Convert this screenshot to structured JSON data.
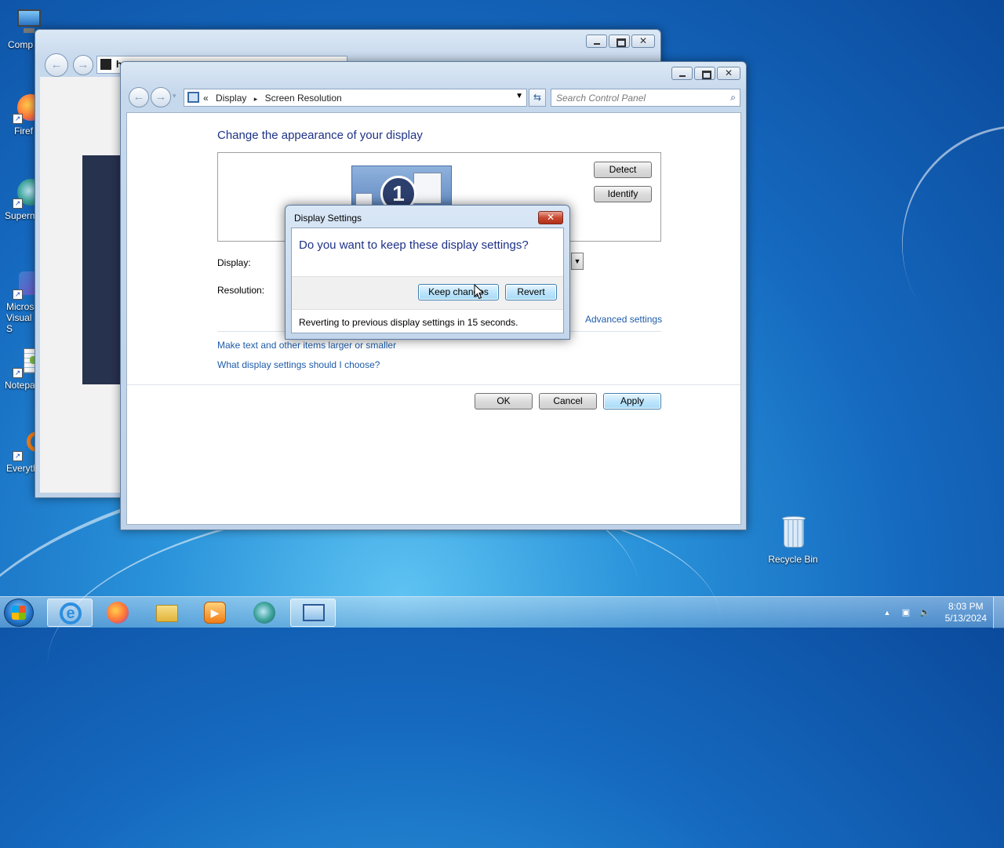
{
  "desktop": {
    "icons": [
      {
        "label": "Comp",
        "icon": "computer-icon"
      },
      {
        "label": "Firef",
        "icon": "firefox-icon"
      },
      {
        "label": "Superm",
        "icon": "supermium-icon"
      },
      {
        "label": "Micros Visual S",
        "icon": "visual-studio-icon"
      },
      {
        "label": "Notepa",
        "icon": "notepad-icon"
      },
      {
        "label": "Everyth",
        "icon": "everything-search-icon"
      },
      {
        "label": "Recycle Bin",
        "icon": "recycle-bin-icon"
      }
    ]
  },
  "back_window": {
    "address_letter": "h"
  },
  "main_window": {
    "breadcrumb": {
      "prefix": "«",
      "items": [
        "Display",
        "Screen Resolution"
      ],
      "separator": "▸"
    },
    "search_placeholder": "Search Control Panel",
    "heading": "Change the appearance of your display",
    "monitor_number": "1",
    "detect_label": "Detect",
    "identify_label": "Identify",
    "display_label": "Display:",
    "resolution_label": "Resolution:",
    "advanced_link": "Advanced settings",
    "link_text_size": "Make text and other items larger or smaller",
    "link_which_settings": "What display settings should I choose?",
    "ok_label": "OK",
    "cancel_label": "Cancel",
    "apply_label": "Apply"
  },
  "dialog": {
    "title": "Display Settings",
    "question": "Do you want to keep these display settings?",
    "keep_label": "Keep changes",
    "revert_label": "Revert",
    "countdown": "Reverting to previous display settings in 15 seconds."
  },
  "taskbar": {
    "items": [
      "internet-explorer-icon",
      "firefox-icon",
      "file-explorer-icon",
      "media-player-icon",
      "supermium-icon",
      "control-panel-icon"
    ],
    "time": "8:03 PM",
    "date": "5/13/2024"
  },
  "colors": {
    "accent_blue": "#1e3287",
    "link_blue": "#1e5baa"
  }
}
